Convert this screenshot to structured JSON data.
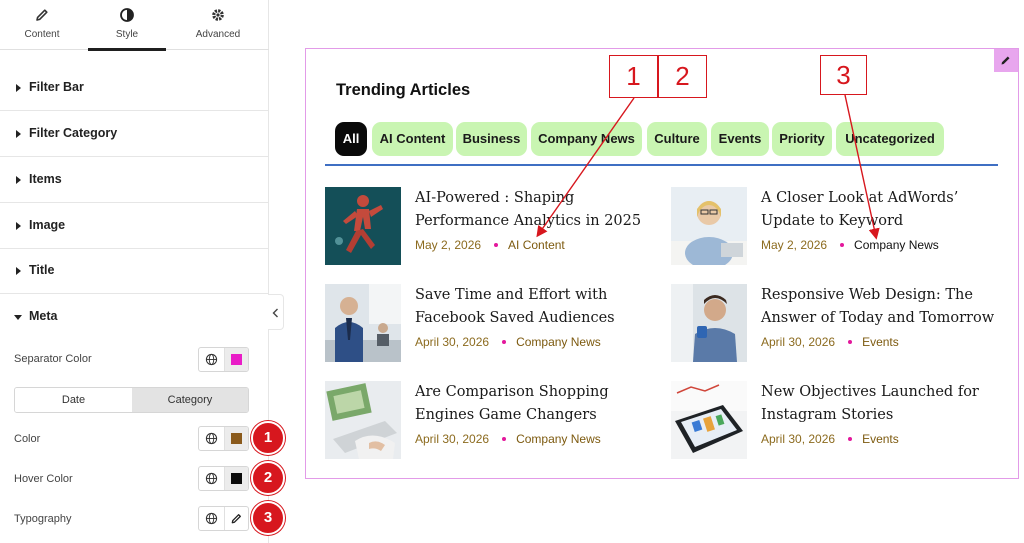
{
  "tabs": [
    {
      "label": "Content",
      "icon": "pencil-icon"
    },
    {
      "label": "Style",
      "icon": "half-circle-icon"
    },
    {
      "label": "Advanced",
      "icon": "gear-icon"
    }
  ],
  "sections": [
    "Filter Bar",
    "Filter Category",
    "Items",
    "Image",
    "Title",
    "Meta"
  ],
  "meta_controls": {
    "separator_color_label": "Separator Color",
    "separator_color": "#e91cc7",
    "toggle": {
      "date": "Date",
      "category": "Category",
      "active": "Category"
    },
    "color_label": "Color",
    "color_value": "#8a5a1c",
    "hover_color_label": "Hover Color",
    "hover_color_value": "#0b0b0b",
    "typography_label": "Typography"
  },
  "badges": [
    "1",
    "2",
    "3"
  ],
  "callouts": [
    "1",
    "2",
    "3"
  ],
  "widget": {
    "title": "Trending Articles",
    "filters": [
      "All",
      "AI Content",
      "Business",
      "Company News",
      "Culture",
      "Events",
      "Priority",
      "Uncategorized"
    ],
    "active_filter": "All",
    "articles": [
      {
        "title": "AI-Powered : Shaping Performance Analytics in 2025",
        "date": "May 2, 2026",
        "category": "AI Content",
        "thumb": "runner-anatomy-image"
      },
      {
        "title": "A Closer Look at AdWords’ Update to Keyword",
        "date": "May 2, 2026",
        "category": "Company News",
        "thumb": "woman-at-laptop-image"
      },
      {
        "title": "Save Time and Effort with Facebook Saved Audiences",
        "date": "April 30, 2026",
        "category": "Company News",
        "thumb": "office-meeting-image"
      },
      {
        "title": "Responsive Web Design: The Answer of Today and Tomorrow",
        "date": "April 30, 2026",
        "category": "Events",
        "thumb": "man-with-coffee-image"
      },
      {
        "title": "Are Comparison Shopping Engines Game Changers",
        "date": "April 30, 2026",
        "category": "Company News",
        "thumb": "laptop-typing-image"
      },
      {
        "title": "New Objectives Launched for Instagram Stories",
        "date": "April 30, 2026",
        "category": "Events",
        "thumb": "tablet-charts-image"
      }
    ]
  },
  "colors": {
    "accent_pill": "#c9f5b2",
    "active_pill": "#0a0a0a",
    "widget_border": "#e29be8",
    "filter_underline": "#3f6fc3",
    "annotation_red": "#d7171e",
    "date_color": "#8c6b1f"
  }
}
